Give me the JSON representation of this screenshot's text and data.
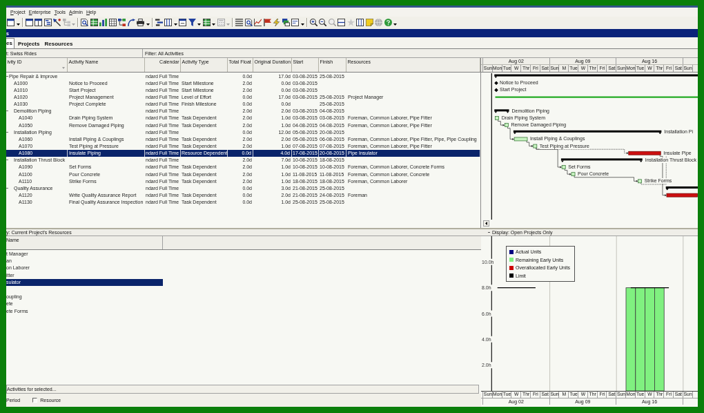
{
  "menu": [
    "Project",
    "Enterprise",
    "Tools",
    "Admin",
    "Help"
  ],
  "toolbar": [
    [
      {
        "disabled": false
      }
    ],
    [
      {
        "disabled": false
      },
      {
        "disabled": false
      },
      {
        "disabled": false
      },
      {
        "disabled": false
      },
      {
        "disabled": true
      }
    ],
    [
      {
        "disabled": false
      },
      {
        "disabled": false
      },
      {
        "disabled": false
      },
      {
        "disabled": false
      },
      {
        "disabled": false
      },
      {
        "disabled": false
      },
      {
        "disabled": false
      }
    ],
    [
      {
        "disabled": false
      },
      {
        "disabled": false
      },
      {
        "disabled": false
      },
      {
        "disabled": false
      },
      {
        "disabled": false
      },
      {
        "disabled": true
      }
    ],
    [
      {
        "disabled": false
      },
      {
        "disabled": false
      },
      {
        "disabled": false
      },
      {
        "disabled": false
      },
      {
        "disabled": false
      },
      {
        "disabled": false
      },
      {
        "disabled": false
      }
    ],
    [
      {
        "disabled": false
      },
      {
        "disabled": false
      },
      {
        "disabled": true
      },
      {
        "disabled": false
      },
      {
        "disabled": true
      },
      {
        "disabled": false
      },
      {
        "disabled": false
      },
      {
        "disabled": true
      },
      {
        "disabled": false
      }
    ]
  ],
  "workspace_bar": {
    "title": "s"
  },
  "tabs": [
    {
      "label": "es",
      "selected": true
    },
    {
      "label": "Projects",
      "selected": false
    },
    {
      "label": "Resources",
      "selected": false
    }
  ],
  "layout_bar": {
    "layout": "t: Swiss Rides",
    "filter": "Filter: All Activities"
  },
  "activities_table": {
    "columns": [
      "ivity ID",
      "Activity Name",
      "Calendar",
      "Activity Type",
      "Total Float",
      "Original Duration",
      "Start",
      "Finish",
      "Resources"
    ],
    "rows": [
      {
        "kind": "wbs",
        "id": "Pipe Repair & Improve",
        "calendar": "ndard Full Time",
        "total_float": "0.0d",
        "original_duration": "17.0d",
        "start": "03-08-2015",
        "finish": "25-08-2015",
        "expanded": true,
        "selected": false,
        "bar": {
          "kind": "summary"
        },
        "children": [
          {
            "kind": "activity",
            "id": "A1000",
            "name": "Notice to Proceed",
            "calendar": "ndard Full Time",
            "type": "Start Milestone",
            "total_float": "2.0d",
            "original_duration": "0.0d",
            "start": "03-08-2015",
            "selected": false,
            "bar": {
              "kind": "milestone",
              "label": "Notice to Proceed"
            }
          },
          {
            "kind": "activity",
            "id": "A1010",
            "name": "Start Project",
            "calendar": "ndard Full Time",
            "type": "Start Milestone",
            "total_float": "2.0d",
            "original_duration": "0.0d",
            "start": "03-08-2015",
            "selected": false,
            "bar": {
              "kind": "milestone",
              "label": "Start Project"
            }
          },
          {
            "kind": "activity",
            "id": "A1020",
            "name": "Project Management",
            "calendar": "ndard Full Time",
            "type": "Level of Effort",
            "total_float": "0.0d",
            "original_duration": "17.0d",
            "start": "03-08-2015",
            "finish": "25-08-2015",
            "resources": "Project Manager",
            "selected": false,
            "bar": {
              "kind": "level_of_effort"
            }
          },
          {
            "kind": "activity",
            "id": "A1030",
            "name": "Project Complete",
            "calendar": "ndard Full Time",
            "type": "Finish Milestone",
            "total_float": "0.0d",
            "original_duration": "0.0d",
            "finish": "25-08-2015",
            "selected": false
          },
          {
            "kind": "wbs",
            "id": "Demolition Piping",
            "calendar": "ndard Full Time",
            "total_float": "2.0d",
            "original_duration": "2.0d",
            "start": "03-08-2015",
            "finish": "04-08-2015",
            "expanded": true,
            "selected": false,
            "bar": {
              "kind": "summary",
              "label": "Demolition Piping"
            },
            "children": [
              {
                "kind": "activity",
                "id": "A1040",
                "name": "Drain Piping System",
                "calendar": "ndard Full Time",
                "type": "Task Dependent",
                "total_float": "2.0d",
                "original_duration": "1.0d",
                "start": "03-08-2015",
                "finish": "03-08-2015",
                "resources": "Foreman, Common Laborer, Pipe Fitter",
                "selected": false,
                "bar": {
                  "kind": "task",
                  "label": "Drain Piping System"
                }
              },
              {
                "kind": "activity",
                "id": "A1050",
                "name": "Remove Damaged Piping",
                "calendar": "ndard Full Time",
                "type": "Task Dependent",
                "total_float": "2.0d",
                "original_duration": "1.0d",
                "start": "04-08-2015",
                "finish": "04-08-2015",
                "resources": "Foreman, Common Laborer, Pipe Fitter",
                "selected": false,
                "bar": {
                  "kind": "task",
                  "label": "Remove Damaged Piping"
                }
              }
            ]
          },
          {
            "kind": "wbs",
            "id": "Installation Piping",
            "calendar": "ndard Full Time",
            "total_float": "0.0d",
            "original_duration": "12.0d",
            "start": "05-08-2015",
            "finish": "20-08-2015",
            "expanded": true,
            "selected": false,
            "bar": {
              "kind": "summary",
              "label": "Installation Pi"
            },
            "children": [
              {
                "kind": "activity",
                "id": "A1060",
                "name": "Install Piping & Couplings",
                "calendar": "ndard Full Time",
                "type": "Task Dependent",
                "total_float": "2.0d",
                "original_duration": "2.0d",
                "start": "05-08-2015",
                "finish": "06-08-2015",
                "resources": "Foreman, Common Laborer, Pipe Fitter, Pipe, Pipe Coupling",
                "selected": false,
                "bar": {
                  "kind": "task",
                  "label": "Install Piping & Couplings"
                }
              },
              {
                "kind": "activity",
                "id": "A1070",
                "name": "Test Piping at Pressure",
                "calendar": "ndard Full Time",
                "type": "Task Dependent",
                "total_float": "2.0d",
                "original_duration": "1.0d",
                "start": "07-08-2015",
                "finish": "07-08-2015",
                "resources": "Foreman, Common Laborer, Pipe Fitter",
                "selected": false,
                "bar": {
                  "kind": "task",
                  "label": "Test Piping at Pressure"
                }
              },
              {
                "kind": "activity",
                "id": "A1080",
                "name": "Insulate Piping",
                "calendar": "ndard Full Time",
                "type": "Resource Dependent",
                "total_float": "0.0d",
                "original_duration": "4.0d",
                "start": "17-08-2015",
                "finish": "20-08-2015",
                "resources": "Pipe Insulator",
                "selected": true,
                "bar": {
                  "kind": "critical",
                  "label": "Insulate Pipe"
                }
              }
            ]
          },
          {
            "kind": "wbs",
            "id": "Installation Thrust Block",
            "calendar": "ndard Full Time",
            "total_float": "2.0d",
            "original_duration": "7.0d",
            "start": "10-08-2015",
            "finish": "18-08-2015",
            "expanded": true,
            "selected": false,
            "bar": {
              "kind": "summary",
              "label": "Installation Thrust Block"
            },
            "children": [
              {
                "kind": "activity",
                "id": "A1090",
                "name": "Set Forms",
                "calendar": "ndard Full Time",
                "type": "Task Dependent",
                "total_float": "2.0d",
                "original_duration": "1.0d",
                "start": "10-08-2015",
                "finish": "10-08-2015",
                "resources": "Foreman, Common Laborer, Concrete Forms",
                "selected": false,
                "bar": {
                  "kind": "task",
                  "label": "Set Forms"
                }
              },
              {
                "kind": "activity",
                "id": "A1100",
                "name": "Pour Concrete",
                "calendar": "ndard Full Time",
                "type": "Task Dependent",
                "total_float": "2.0d",
                "original_duration": "1.0d",
                "start": "11-08-2015",
                "finish": "11-08-2015",
                "resources": "Foreman, Common Laborer, Concrete",
                "selected": false,
                "bar": {
                  "kind": "task",
                  "label": "Pour Concrete"
                }
              },
              {
                "kind": "activity",
                "id": "A1110",
                "name": "Strike Forms",
                "calendar": "ndard Full Time",
                "type": "Task Dependent",
                "total_float": "2.0d",
                "original_duration": "1.0d",
                "start": "18-08-2015",
                "finish": "18-08-2015",
                "resources": "Foreman, Common Laborer",
                "selected": false,
                "bar": {
                  "kind": "task",
                  "label": "Strike Forms"
                }
              }
            ]
          },
          {
            "kind": "wbs",
            "id": "Quality Assurance",
            "calendar": "ndard Full Time",
            "total_float": "0.0d",
            "original_duration": "3.0d",
            "start": "21-08-2015",
            "finish": "25-08-2015",
            "expanded": true,
            "selected": false,
            "bar": {
              "kind": "summary"
            },
            "children": [
              {
                "kind": "activity",
                "id": "A1120",
                "name": "Write Quality Assurance Report",
                "calendar": "ndard Full Time",
                "type": "Task Dependent",
                "total_float": "0.0d",
                "original_duration": "2.0d",
                "start": "21-08-2015",
                "finish": "24-08-2015",
                "resources": "Foreman",
                "selected": false,
                "bar": {
                  "kind": "critical"
                }
              },
              {
                "kind": "activity",
                "id": "A1130",
                "name": "Final Quality Assurance Inspection",
                "calendar": "ndard Full Time",
                "type": "Task Dependent",
                "total_float": "0.0d",
                "original_duration": "1.0d",
                "start": "25-08-2015",
                "finish": "25-08-2015",
                "selected": false
              }
            ]
          }
        ]
      }
    ]
  },
  "gantt": {
    "weeks": [
      "Aug 02",
      "Aug 09",
      "Aug 16"
    ],
    "days": [
      "Sun",
      "Mon",
      "Tue",
      "W",
      "Thr",
      "Fri",
      "Sat",
      "Sun",
      "M",
      "Tue",
      "W",
      "Thr",
      "Fri",
      "Sat",
      "Sun",
      "Mon",
      "Tue",
      "W",
      "Thr",
      "Fri",
      "Sat",
      "Sun"
    ]
  },
  "resources_panel": {
    "title": "y: Current Project's Resources",
    "column": "Name",
    "rows": [
      {
        "name": "t Manager",
        "selected": false
      },
      {
        "name": "an",
        "selected": false
      },
      {
        "name": "on Laborer",
        "selected": false
      },
      {
        "name": "itter",
        "selected": false
      },
      {
        "name": "sulator",
        "selected": true
      },
      {
        "selected": false
      },
      {
        "name": "oupling",
        "selected": false
      },
      {
        "name": "ete",
        "selected": false
      },
      {
        "name": "ete Forms",
        "selected": false
      }
    ]
  },
  "activities_bar": "Activities for selected...",
  "options": {
    "period": "Period",
    "resource": {
      "label": "Resource",
      "checked": false
    }
  },
  "usage_panel": {
    "title": "Display: Open Projects Only",
    "chart_data": {
      "type": "bar",
      "categories": [
        "Sun",
        "Mon",
        "Tue",
        "W",
        "Thr",
        "Fri",
        "Sat",
        "Sun",
        "M",
        "Tue",
        "W",
        "Thr",
        "Fri",
        "Sat",
        "Sun",
        "Mon",
        "Tue",
        "W",
        "Thr",
        "Fri",
        "Sat",
        "Sun"
      ],
      "series": [
        {
          "name": "Actual Units",
          "color": "#000080",
          "values": [
            null,
            null,
            null,
            null,
            null,
            null,
            null,
            null,
            null,
            null,
            null,
            null,
            null,
            null,
            null,
            null,
            null,
            null,
            null,
            null,
            null,
            null
          ]
        },
        {
          "name": "Remaining Early Units",
          "color": "#80f080",
          "values": [
            null,
            null,
            null,
            null,
            null,
            null,
            null,
            null,
            null,
            null,
            null,
            null,
            null,
            null,
            null,
            8,
            8,
            8,
            8,
            null,
            null,
            null
          ]
        },
        {
          "name": "Overallocated Early Units",
          "color": "#cc0000",
          "values": [
            null,
            null,
            null,
            null,
            null,
            null,
            null,
            null,
            null,
            null,
            null,
            null,
            null,
            null,
            null,
            null,
            null,
            null,
            null,
            null,
            null,
            null
          ]
        },
        {
          "name": "Limit",
          "color": "#000000",
          "type": "line",
          "values": [
            null,
            8,
            8,
            8,
            8,
            8,
            null,
            null,
            null,
            null,
            null,
            null,
            null,
            null,
            null,
            8,
            8,
            8,
            8,
            8,
            null,
            null
          ]
        }
      ],
      "ylim": [
        0,
        12
      ],
      "yticks": [
        {
          "value": 2,
          "label": "2.0h"
        },
        {
          "value": 4,
          "label": "4.0h"
        },
        {
          "value": 6,
          "label": "6.0h"
        },
        {
          "value": 8,
          "label": "8.0h"
        },
        {
          "value": 10,
          "label": "10.0h"
        }
      ],
      "legend": "upper left"
    },
    "weeks": [
      "Aug 02",
      "Aug 09",
      "Aug 16"
    ]
  }
}
